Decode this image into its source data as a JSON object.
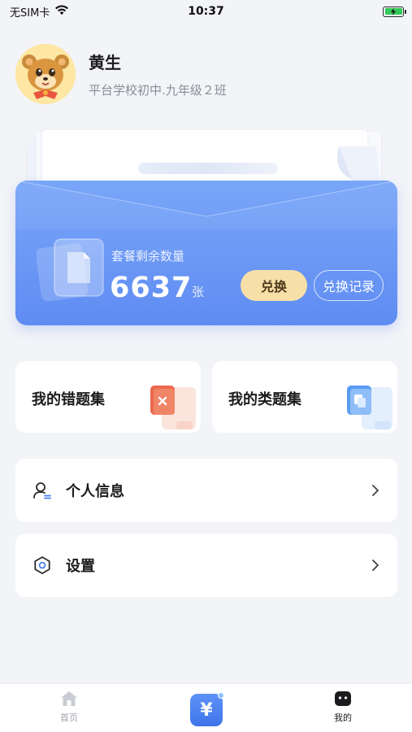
{
  "status_bar": {
    "carrier": "无SIM卡",
    "time": "10:37"
  },
  "profile": {
    "name": "黄生",
    "school": "平台学校初中.九年级２班"
  },
  "package": {
    "label": "套餐剩余数量",
    "count": "6637",
    "unit": "张",
    "redeem_label": "兑换",
    "record_label": "兑换记录"
  },
  "tiles": {
    "wrong_questions": "我的错题集",
    "similar_questions": "我的类题集"
  },
  "menu": {
    "personal_info": "个人信息",
    "settings": "设置"
  },
  "tab_bar": {
    "home_label": "首页",
    "center_symbol": "¥",
    "mine_label": "我的"
  },
  "colors": {
    "card_blue": "#6b97f5",
    "redeem_gold": "#f7dfa8",
    "battery_green": "#34c759",
    "tile_red": "#e9694f",
    "tile_blue": "#5b9bf3"
  }
}
